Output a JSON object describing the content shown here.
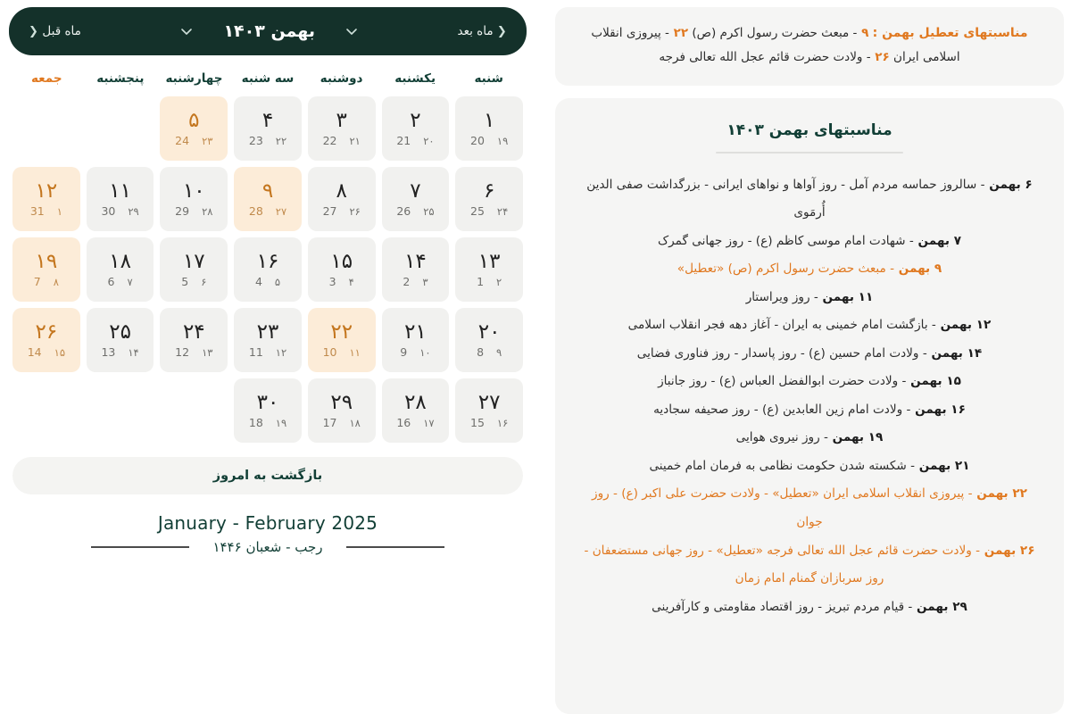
{
  "holiday_banner": {
    "title": "مناسبتهای تعطیل بهمن :",
    "items": [
      {
        "day": "۹",
        "text": "- مبعث حضرت رسول اکرم (ص)"
      },
      {
        "day": "۲۲",
        "text": "- پیروزی انقلاب اسلامی ایران"
      },
      {
        "day": "۲۶",
        "text": "- ولادت حضرت قائم عجل الله تعالی فرجه"
      }
    ]
  },
  "events": {
    "title": "مناسبتهای بهمن ۱۴۰۳",
    "items": [
      {
        "day": "۶ بهمن",
        "text": "- سالروز حماسه مردم آمل - روز آواها و نواهای ایرانی - بزرگداشت صفی الدین أُرمَوی",
        "holiday": false
      },
      {
        "day": "۷ بهمن",
        "text": "- شهادت امام موسی کاظم (ع) - روز جهانی گمرک",
        "holiday": false
      },
      {
        "day": "۹ بهمن",
        "text": "- مبعث حضرت رسول اکرم (ص) «تعطیل»",
        "holiday": true
      },
      {
        "day": "۱۱ بهمن",
        "text": "- روز ویراستار",
        "holiday": false
      },
      {
        "day": "۱۲ بهمن",
        "text": "- بازگشت امام خمینی به ایران - آغاز دهه فجر انقلاب اسلامی",
        "holiday": false
      },
      {
        "day": "۱۴ بهمن",
        "text": "- ولادت امام حسین (ع) - روز پاسدار - روز فناوری فضایی",
        "holiday": false
      },
      {
        "day": "۱۵ بهمن",
        "text": "- ولادت حضرت ابوالفضل العباس (ع) - روز جانباز",
        "holiday": false
      },
      {
        "day": "۱۶ بهمن",
        "text": "- ولادت امام زین العابدین (ع) - روز صحیفه سجادیه",
        "holiday": false
      },
      {
        "day": "۱۹ بهمن",
        "text": "- روز نیروی هوایی",
        "holiday": false
      },
      {
        "day": "۲۱ بهمن",
        "text": "- شکسته شدن حکومت نظامی به فرمان امام خمینی",
        "holiday": false
      },
      {
        "day": "۲۲ بهمن",
        "text": "- پیروزی انقلاب اسلامی ایران «تعطیل» - ولادت حضرت علی اکبر (ع) - روز جوان",
        "holiday": true
      },
      {
        "day": "۲۶ بهمن",
        "text": "- ولادت حضرت قائم عجل الله تعالی فرجه «تعطیل» - روز جهانی مستضعفان - روز سربازان گمنام امام زمان",
        "holiday": true
      },
      {
        "day": "۲۹ بهمن",
        "text": "- قیام مردم تبریز - روز اقتصاد مقاومتی و کارآفرینی",
        "holiday": false
      }
    ]
  },
  "calendar": {
    "prev_label": "ماه قبل",
    "prev_chevron": "❮",
    "next_label": "ماه بعد",
    "next_chevron": "❮",
    "month_title": "بهمن ۱۴۰۳",
    "today_button": "بازگشت به امروز",
    "gregorian_range": "January - February  2025",
    "hijri_range": "رجب - شعبان ۱۴۴۶",
    "weekdays": [
      {
        "label": "شنبه",
        "friday": false
      },
      {
        "label": "یکشنبه",
        "friday": false
      },
      {
        "label": "دوشنبه",
        "friday": false
      },
      {
        "label": "سه شنبه",
        "friday": false
      },
      {
        "label": "چهارشنبه",
        "friday": false
      },
      {
        "label": "پنجشنبه",
        "friday": false
      },
      {
        "label": "جمعه",
        "friday": true
      }
    ],
    "weeks": [
      [
        {
          "jalali": "۱",
          "hijri": "۱۹",
          "greg": "20",
          "highlight": false
        },
        {
          "jalali": "۲",
          "hijri": "۲۰",
          "greg": "21",
          "highlight": false
        },
        {
          "jalali": "۳",
          "hijri": "۲۱",
          "greg": "22",
          "highlight": false
        },
        {
          "jalali": "۴",
          "hijri": "۲۲",
          "greg": "23",
          "highlight": false
        },
        {
          "jalali": "۵",
          "hijri": "۲۳",
          "greg": "24",
          "highlight": true
        },
        {
          "empty": true
        },
        {
          "empty": true
        }
      ],
      [
        {
          "jalali": "۶",
          "hijri": "۲۴",
          "greg": "25",
          "highlight": false
        },
        {
          "jalali": "۷",
          "hijri": "۲۵",
          "greg": "26",
          "highlight": false
        },
        {
          "jalali": "۸",
          "hijri": "۲۶",
          "greg": "27",
          "highlight": false
        },
        {
          "jalali": "۹",
          "hijri": "۲۷",
          "greg": "28",
          "highlight": true
        },
        {
          "jalali": "۱۰",
          "hijri": "۲۸",
          "greg": "29",
          "highlight": false
        },
        {
          "jalali": "۱۱",
          "hijri": "۲۹",
          "greg": "30",
          "highlight": false
        },
        {
          "jalali": "۱۲",
          "hijri": "۱",
          "greg": "31",
          "highlight": true
        }
      ],
      [
        {
          "jalali": "۱۳",
          "hijri": "۲",
          "greg": "1",
          "highlight": false
        },
        {
          "jalali": "۱۴",
          "hijri": "۳",
          "greg": "2",
          "highlight": false
        },
        {
          "jalali": "۱۵",
          "hijri": "۴",
          "greg": "3",
          "highlight": false
        },
        {
          "jalali": "۱۶",
          "hijri": "۵",
          "greg": "4",
          "highlight": false
        },
        {
          "jalali": "۱۷",
          "hijri": "۶",
          "greg": "5",
          "highlight": false
        },
        {
          "jalali": "۱۸",
          "hijri": "۷",
          "greg": "6",
          "highlight": false
        },
        {
          "jalali": "۱۹",
          "hijri": "۸",
          "greg": "7",
          "highlight": true
        }
      ],
      [
        {
          "jalali": "۲۰",
          "hijri": "۹",
          "greg": "8",
          "highlight": false
        },
        {
          "jalali": "۲۱",
          "hijri": "۱۰",
          "greg": "9",
          "highlight": false
        },
        {
          "jalali": "۲۲",
          "hijri": "۱۱",
          "greg": "10",
          "highlight": true
        },
        {
          "jalali": "۲۳",
          "hijri": "۱۲",
          "greg": "11",
          "highlight": false
        },
        {
          "jalali": "۲۴",
          "hijri": "۱۳",
          "greg": "12",
          "highlight": false
        },
        {
          "jalali": "۲۵",
          "hijri": "۱۴",
          "greg": "13",
          "highlight": false
        },
        {
          "jalali": "۲۶",
          "hijri": "۱۵",
          "greg": "14",
          "highlight": true
        }
      ],
      [
        {
          "jalali": "۲۷",
          "hijri": "۱۶",
          "greg": "15",
          "highlight": false
        },
        {
          "jalali": "۲۸",
          "hijri": "۱۷",
          "greg": "16",
          "highlight": false
        },
        {
          "jalali": "۲۹",
          "hijri": "۱۸",
          "greg": "17",
          "highlight": false
        },
        {
          "jalali": "۳۰",
          "hijri": "۱۹",
          "greg": "18",
          "highlight": false
        },
        {
          "empty": true
        },
        {
          "empty": true
        },
        {
          "empty": true
        }
      ]
    ]
  },
  "colors": {
    "header_green": "#14312a",
    "accent_orange": "#e0781f",
    "highlight_bg": "#fcecd8",
    "cell_bg": "#f1f1ef",
    "panel_bg": "#f5f5f4"
  }
}
